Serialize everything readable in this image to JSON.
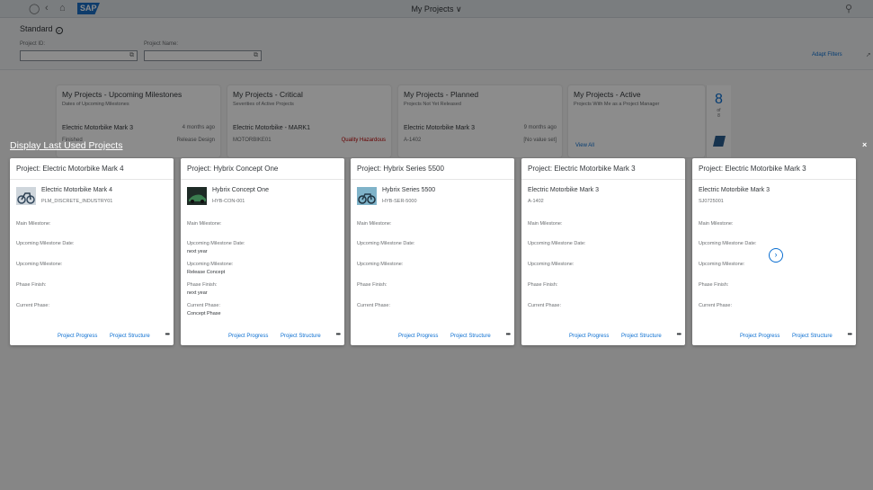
{
  "shell": {
    "title": "My Projects ∨",
    "logo": "SAP"
  },
  "filterbar": {
    "variant": "Standard",
    "project_id_label": "Project ID:",
    "project_name_label": "Project Name:",
    "adapt_filters": "Adapt Filters"
  },
  "tiles": [
    {
      "title": "My Projects - Upcoming Milestones",
      "subtitle": "Dates of Upcoming Milestones",
      "row_name": "Electric Motorbike Mark 3",
      "row_right": "4 months ago",
      "row2_left": "Finished",
      "row2_right": "Release Design"
    },
    {
      "title": "My Projects - Critical",
      "subtitle": "Severities of Active Projects",
      "row_name": "Electric Motorbike - MARK1",
      "row_right": "",
      "row2_left": "MOTORBIKE01",
      "row2_right": "Quality Hazardous"
    },
    {
      "title": "My Projects - Planned",
      "subtitle": "Projects Not Yet Released",
      "row_name": "Electric Motorbike Mark 3",
      "row_right": "9 months ago",
      "row2_left": "A-1402",
      "row2_right": "[No value set]"
    },
    {
      "title": "My Projects - Active",
      "subtitle": "Projects With Me as a Project Manager",
      "view_all": "View All",
      "kpi_value": "8",
      "kpi_of": "of",
      "kpi_total": "8"
    }
  ],
  "dialog": {
    "title": "Display Last Used Projects",
    "close": "×",
    "next": "›",
    "labels": {
      "main_milestone": "Main Milestone:",
      "upcoming_date": "Upcoming Milestone Date:",
      "upcoming_milestone": "Upcoming Milestone:",
      "phase_finish": "Phase Finish:",
      "current_phase": "Current Phase:",
      "progress": "Project Progress",
      "structure": "Project Structure",
      "more": "•••"
    },
    "cards": [
      {
        "header": "Project: Electric Motorbike Mark 4",
        "name": "Electric Motorbike Mark 4",
        "id": "PLM_DISCRETE_INDUSTRY01",
        "has_image": true,
        "upcoming_date": "",
        "upcoming_milestone": "",
        "phase_finish": "",
        "current_phase": ""
      },
      {
        "header": "Project: Hybrix Concept One",
        "name": "Hybrix Concept One",
        "id": "HYB-CON-001",
        "has_image": true,
        "upcoming_date": "next year",
        "upcoming_milestone": "Release Concept",
        "phase_finish": "next year",
        "current_phase": "Concept Phase"
      },
      {
        "header": "Project: Hybrix Series 5500",
        "name": "Hybrix Series 5500",
        "id": "HYB-SER-5000",
        "has_image": true,
        "upcoming_date": "",
        "upcoming_milestone": "",
        "phase_finish": "",
        "current_phase": ""
      },
      {
        "header": "Project: Electric Motorbike Mark 3",
        "name": "Electric Motorbike Mark 3",
        "id": "A-1402",
        "has_image": false,
        "upcoming_date": "",
        "upcoming_milestone": "",
        "phase_finish": "",
        "current_phase": ""
      },
      {
        "header": "Project: Electric Motorbike Mark 3",
        "name": "Electric Motorbike Mark 3",
        "id": "SJ0725001",
        "has_image": false,
        "upcoming_date": "",
        "upcoming_milestone": "",
        "phase_finish": "",
        "current_phase": ""
      }
    ]
  },
  "colors": {
    "accent": "#0a6ed1",
    "shell_bg": "#dfe3e7",
    "overlay": "#000000",
    "critical": "#bb0000"
  }
}
